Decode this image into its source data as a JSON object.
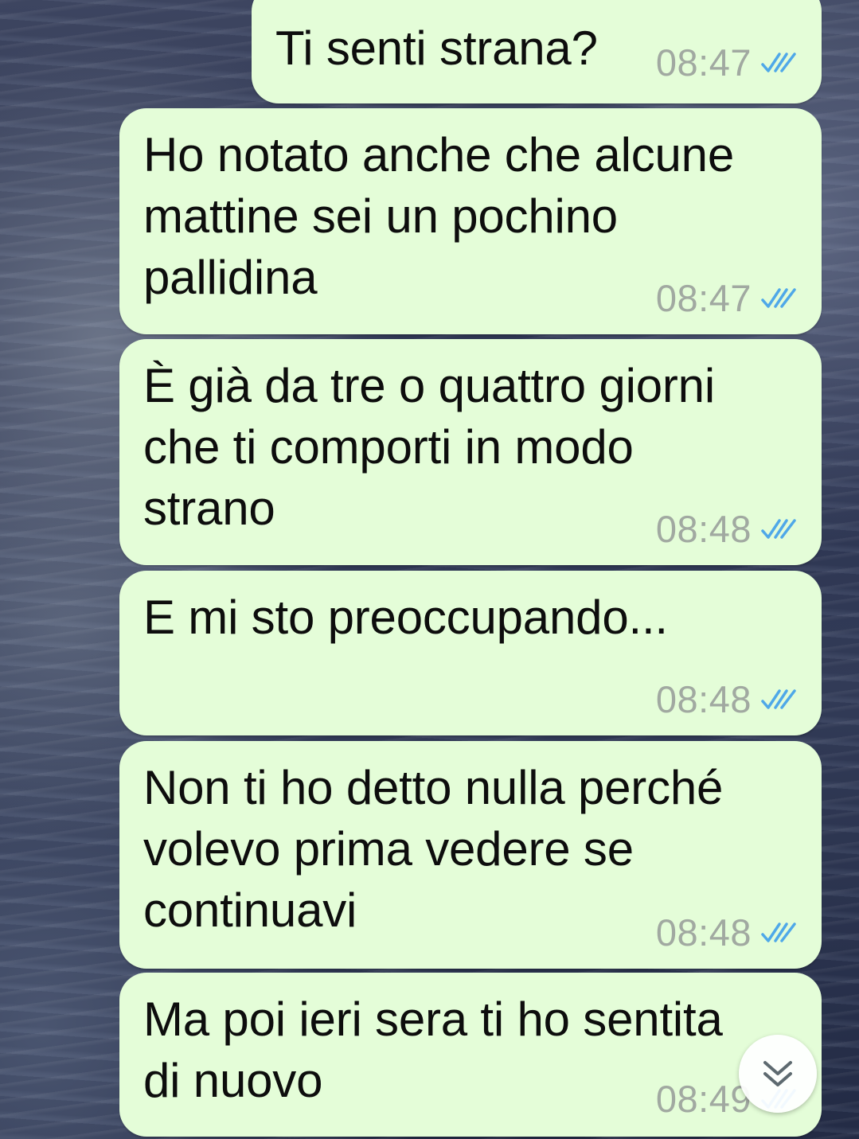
{
  "chat": {
    "messages": [
      {
        "text": "Ti senti strana?",
        "time": "08:47",
        "status_icon": "double-check-read-icon"
      },
      {
        "text": "Ho notato anche che alcune\nmattine sei un pochino\npallidina",
        "time": "08:47",
        "status_icon": "double-check-read-icon"
      },
      {
        "text": "È già da tre o quattro giorni\nche ti comporti in modo\nstrano",
        "time": "08:48",
        "status_icon": "double-check-read-icon"
      },
      {
        "text": "E mi sto preoccupando...",
        "time": "08:48",
        "status_icon": "double-check-read-icon"
      },
      {
        "text": "Non ti ho detto nulla perché\nvolevo prima vedere se\ncontinuavi",
        "time": "08:48",
        "status_icon": "double-check-read-icon"
      },
      {
        "text": "Ma poi ieri sera ti ho sentita\ndi nuovo",
        "time": "08:49",
        "status_icon": "double-check-read-icon"
      }
    ],
    "scroll_down_icon": "double-chevron-down-icon"
  },
  "colors": {
    "bubble_background": "#e4fdd8",
    "message_text": "#0d0d0d",
    "timestamp": "#a1a9a1",
    "read_ticks": "#4fa8e8"
  }
}
